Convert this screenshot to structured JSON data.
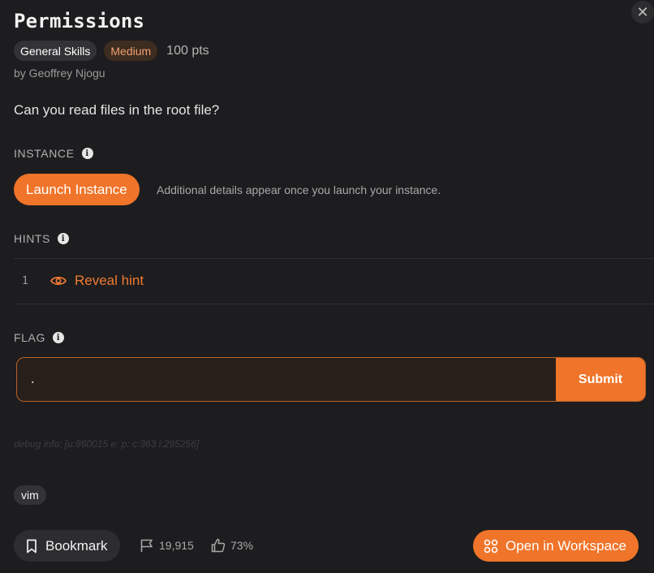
{
  "challenge": {
    "title": "Permissions",
    "category": "General Skills",
    "difficulty": "Medium",
    "points": "100 pts",
    "author": "by Geoffrey Njogu",
    "description": "Can you read files in the root file?"
  },
  "instance": {
    "label": "INSTANCE",
    "launch_label": "Launch Instance",
    "note": "Additional details appear once you launch your instance."
  },
  "hints": {
    "label": "HINTS",
    "items": [
      {
        "number": "1",
        "label": "Reveal hint"
      }
    ]
  },
  "flag": {
    "label": "FLAG",
    "value": ".",
    "submit_label": "Submit"
  },
  "debug": "debug info: [u:860015 e: p: c:363 i:295256]",
  "tags": [
    "vim"
  ],
  "footer": {
    "bookmark_label": "Bookmark",
    "solves": "19,915",
    "likes": "73%",
    "workspace_label": "Open in Workspace"
  },
  "colors": {
    "accent": "#f07429",
    "background": "#1d1d1f",
    "difficulty_text": "#f0a070"
  },
  "icons": {
    "close": "close-icon",
    "info": "info-icon",
    "reveal": "eye-icon",
    "bookmark": "bookmark-icon",
    "solves": "flag-icon",
    "likes": "thumbs-up-icon",
    "workspace": "workspace-grid-icon"
  }
}
